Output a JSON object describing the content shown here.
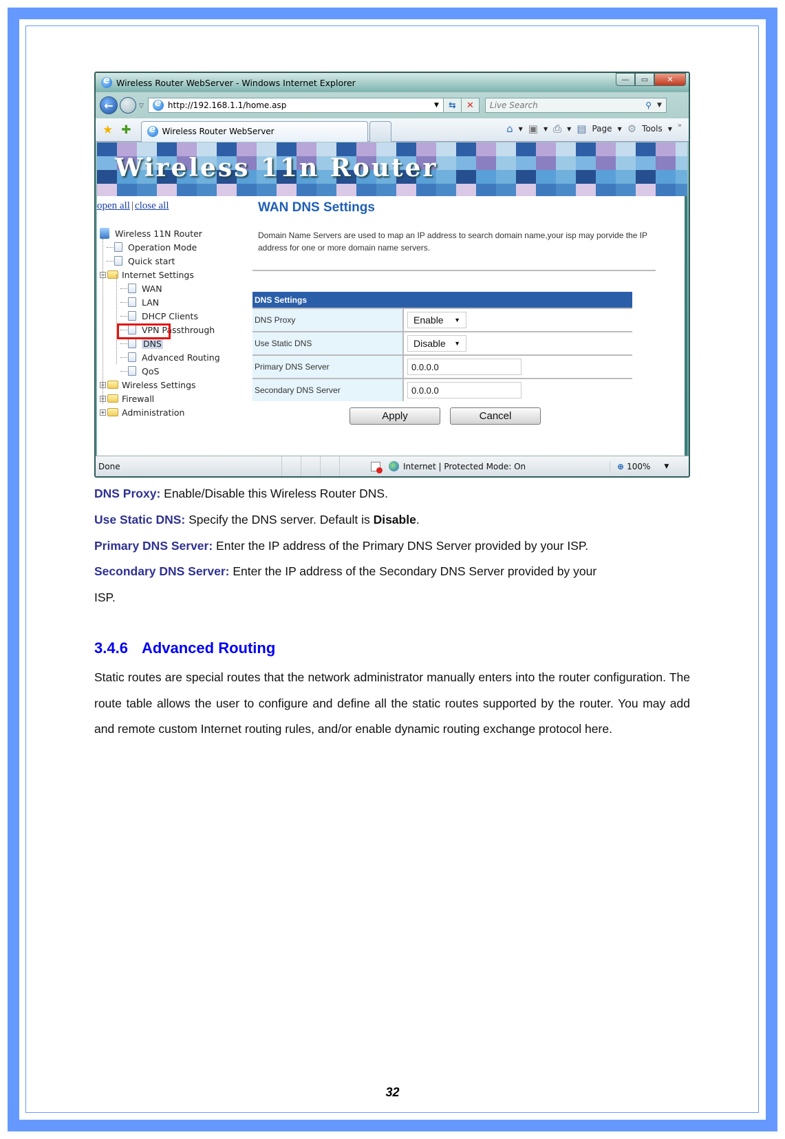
{
  "browser": {
    "window_title": "Wireless Router WebServer - Windows Internet Explorer",
    "address_url": "http://192.168.1.1/home.asp",
    "search_placeholder": "Live Search",
    "tab_title": "Wireless Router WebServer",
    "window_controls": {
      "minimize": "—",
      "maximize": "▭",
      "close": "✕"
    },
    "command_bar": {
      "page_label": "Page",
      "tools_label": "Tools",
      "more": "»"
    },
    "status": {
      "text": "Done",
      "zone": "Internet | Protected Mode: On",
      "zoom": "100%"
    }
  },
  "router": {
    "banner_title": "Wireless 11n Router",
    "sidebar": {
      "open_all": "open all",
      "separator": "|",
      "close_all": "close all",
      "tree": [
        {
          "label": "Wireless 11N Router",
          "type": "root"
        },
        {
          "label": "Operation Mode",
          "type": "page",
          "level": 1
        },
        {
          "label": "Quick start",
          "type": "page",
          "level": 1
        },
        {
          "label": "Internet Settings",
          "type": "folder",
          "expanded": true,
          "level": 1
        },
        {
          "label": "WAN",
          "type": "page",
          "level": 2
        },
        {
          "label": "LAN",
          "type": "page",
          "level": 2
        },
        {
          "label": "DHCP Clients",
          "type": "page",
          "level": 2
        },
        {
          "label": "VPN Passthrough",
          "type": "page",
          "level": 2
        },
        {
          "label": "DNS",
          "type": "page",
          "level": 2,
          "selected": true
        },
        {
          "label": "Advanced Routing",
          "type": "page",
          "level": 2
        },
        {
          "label": "QoS",
          "type": "page",
          "level": 2
        },
        {
          "label": "Wireless Settings",
          "type": "folder",
          "expanded": false,
          "level": 1
        },
        {
          "label": "Firewall",
          "type": "folder",
          "expanded": false,
          "level": 1
        },
        {
          "label": "Administration",
          "type": "folder",
          "expanded": false,
          "level": 1
        }
      ]
    },
    "page_title": "WAN DNS Settings",
    "description": "Domain Name Servers are used to map an IP address to search domain name,your isp may porvide the IP address for one or more domain name servers.",
    "table": {
      "header": "DNS Settings",
      "rows": [
        {
          "label": "DNS Proxy",
          "kind": "select",
          "value": "Enable"
        },
        {
          "label": "Use Static DNS",
          "kind": "select",
          "value": "Disable"
        },
        {
          "label": "Primary DNS Server",
          "kind": "text",
          "value": "0.0.0.0"
        },
        {
          "label": "Secondary DNS Server",
          "kind": "text",
          "value": "0.0.0.0"
        }
      ]
    },
    "buttons": {
      "apply": "Apply",
      "cancel": "Cancel"
    }
  },
  "document": {
    "definitions": [
      {
        "term": "DNS Proxy:",
        "text": " Enable/Disable this Wireless Router DNS."
      },
      {
        "term": "Use Static DNS:",
        "text": " Specify the DNS server. Default is ",
        "bold": "Disable",
        "tail": "."
      },
      {
        "term": "Primary DNS Server:",
        "text": " Enter the IP address of the Primary DNS Server provided by your ISP."
      },
      {
        "term": "Secondary DNS Server:",
        "text": " Enter the IP address of the Secondary DNS Server provided by your",
        "continuation": "ISP."
      }
    ],
    "section": {
      "number": "3.4.6",
      "title": "Advanced Routing"
    },
    "section_body": "Static routes are special routes that the network administrator manually enters into the router configuration. The route table allows the user to configure and define all the static routes supported by the router. You may add and remote custom Internet routing rules, and/or enable dynamic routing exchange protocol here.",
    "page_number": "32"
  },
  "colors": {
    "frame_blue": "#6699ff",
    "term_color": "#2e3192",
    "heading_color": "#0000f0",
    "table_header": "#2a5ea8",
    "highlight_red": "#e3140f"
  }
}
